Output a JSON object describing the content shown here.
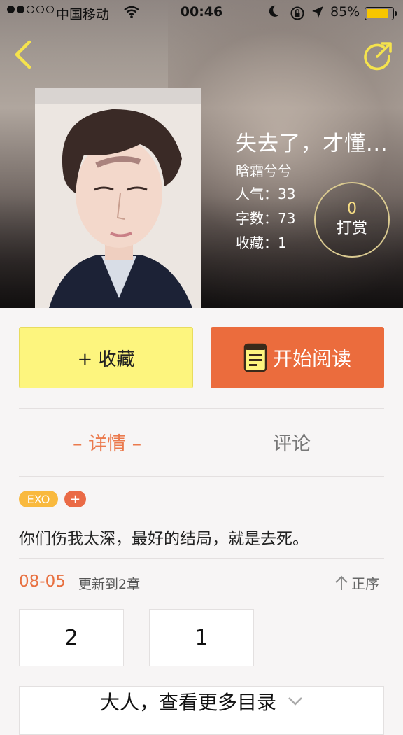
{
  "status_bar": {
    "carrier": "中国移动",
    "time": "00:46",
    "battery": "85%"
  },
  "book": {
    "title": "失去了，才懂...",
    "author": "晗霜兮兮",
    "popularity": "人气：33",
    "word_count": "字数：73",
    "favorites": "收藏：1"
  },
  "tip": {
    "count": "0",
    "label": "打赏"
  },
  "actions": {
    "favorite_label": "+ 收藏",
    "read_label": "开始阅读"
  },
  "tabs": {
    "detail": "– 详情 –",
    "comment": "评论"
  },
  "tags": {
    "primary": "EXO",
    "add": "+"
  },
  "intro": "你们伤我太深，最好的结局，就是去死。",
  "update": {
    "date": "08-05",
    "text": "更新到2章",
    "sort_label": "正序"
  },
  "chapters": [
    "2",
    "1"
  ],
  "more_label": "大人，查看更多目录",
  "colors": {
    "accent_orange": "#eb6c3d",
    "favorite_yellow": "#fdf57e",
    "nav_icon_yellow": "#f5e34d"
  },
  "icons": {
    "back": "chevron-left-icon",
    "share": "share-icon",
    "read": "book-icon",
    "sort": "arrow-up-icon",
    "more": "chevron-down-icon"
  }
}
